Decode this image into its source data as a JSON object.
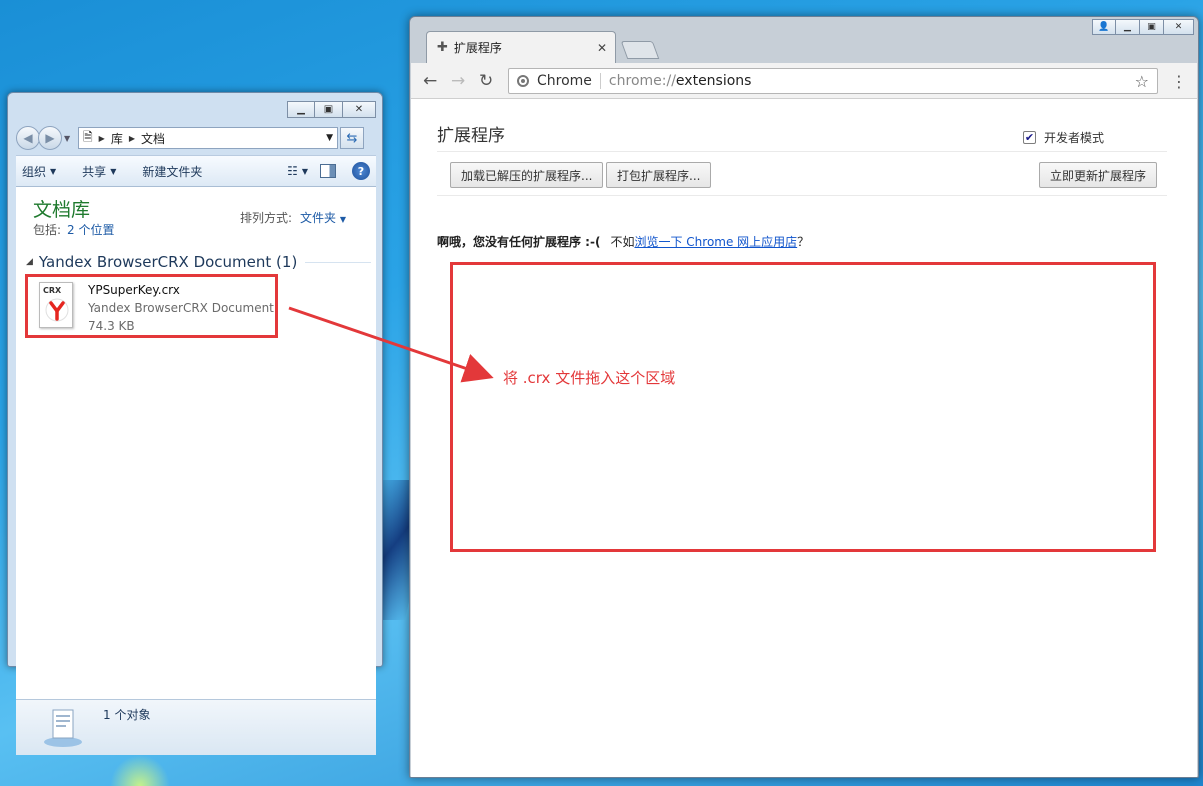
{
  "explorer": {
    "address": {
      "crumbs": [
        "库",
        "文档"
      ]
    },
    "toolbar": {
      "organize": "组织",
      "share": "共享",
      "new_folder": "新建文件夹"
    },
    "library": {
      "title": "文档库",
      "includes_label": "包括:",
      "includes_link": "2 个位置",
      "sort_label": "排列方式:",
      "sort_value": "文件夹"
    },
    "group_title": "Yandex BrowserCRX Document (1)",
    "file": {
      "badge": "CRX",
      "name": "YPSuperKey.crx",
      "type": "Yandex BrowserCRX Document",
      "size": "74.3 KB"
    },
    "status": "1 个对象"
  },
  "chrome": {
    "tab_title": "扩展程序",
    "omnibox": {
      "origin": "Chrome",
      "scheme": "chrome://",
      "path": "extensions"
    },
    "page": {
      "title": "扩展程序",
      "developer_mode_label": "开发者模式",
      "developer_mode_checked": true,
      "buttons": {
        "load_unpacked": "加载已解压的扩展程序...",
        "pack": "打包扩展程序...",
        "update": "立即更新扩展程序"
      },
      "no_extensions": "啊哦，您没有任何扩展程序 :-(",
      "suggest_prefix": "不如",
      "suggest_link": "浏览一下 Chrome 网上应用店",
      "suggest_suffix": "？"
    }
  },
  "annotation": {
    "drop_text": "将 .crx 文件拖入这个区域",
    "color": "#e3383a"
  }
}
